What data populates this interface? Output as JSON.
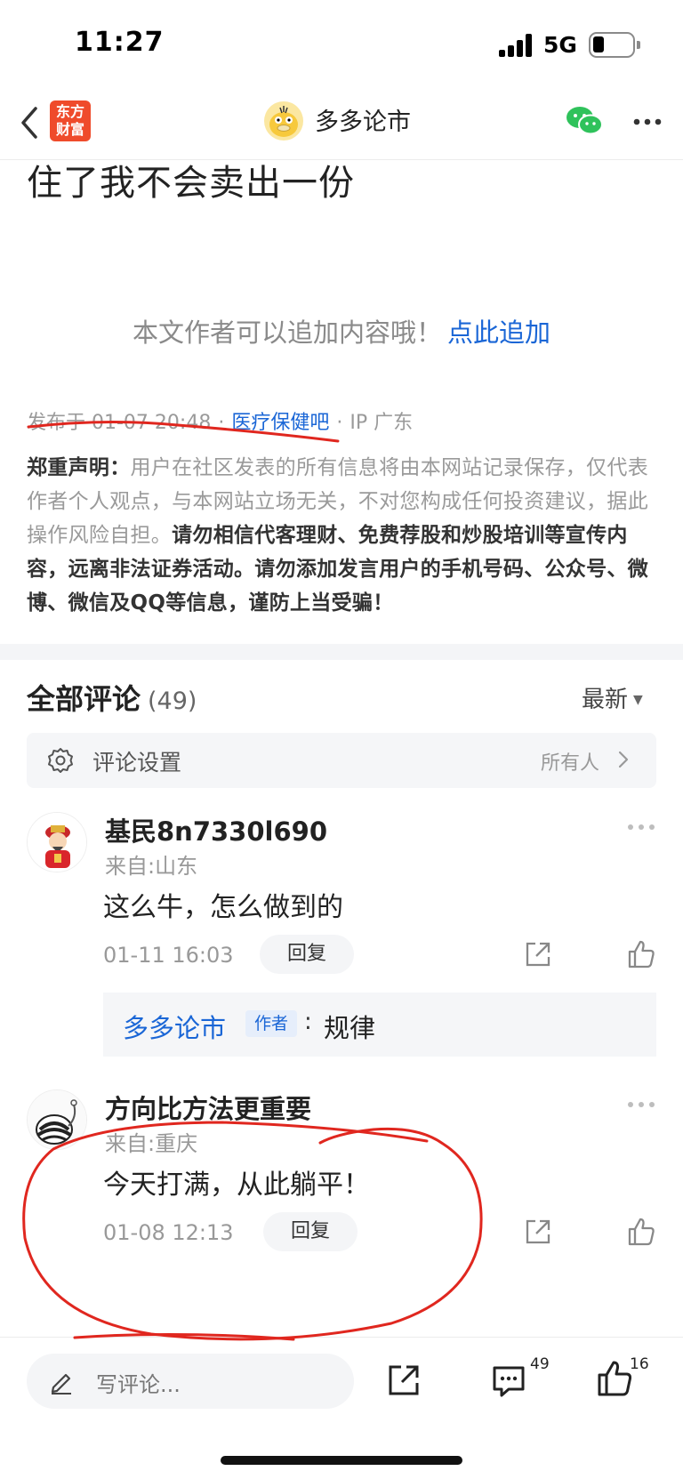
{
  "status_bar": {
    "time": "11:27",
    "network": "5G"
  },
  "nav": {
    "brand_logo_line1": "东方",
    "brand_logo_line2": "财富",
    "title": "多多论市"
  },
  "article": {
    "tail_text": "住了我不会卖出一份",
    "append_prompt": "本文作者可以追加内容哦！",
    "append_link": "点此追加",
    "published": "发布于 01-07 20:48",
    "bar_name": "医疗保健吧",
    "ip": "IP 广东",
    "disclaimer_label": "郑重声明：",
    "disclaimer_plain": "用户在社区发表的所有信息将由本网站记录保存，仅代表作者个人观点，与本网站立场无关，不对您构成任何投资建议，据此操作风险自担。",
    "disclaimer_bold": "请勿相信代客理财、免费荐股和炒股培训等宣传内容，远离非法证券活动。请勿添加发言用户的手机号码、公众号、微博、微信及QQ等信息，谨防上当受骗！"
  },
  "comments_section": {
    "title": "全部评论",
    "count": "(49)",
    "sort_label": "最新",
    "settings_label": "评论设置",
    "settings_value": "所有人"
  },
  "comments": [
    {
      "name": "基民8n7330l690",
      "from": "来自:山东",
      "text": "这么牛，怎么做到的",
      "time": "01-11 16:03",
      "reply_label": "回复",
      "sub_reply": {
        "name": "多多论市",
        "badge": "作者",
        "colon": ":",
        "text": "规律"
      }
    },
    {
      "name": "方向比方法更重要",
      "from": "来自:重庆",
      "text": "今天打满，从此躺平！",
      "time": "01-08 12:13",
      "reply_label": "回复"
    }
  ],
  "bottom_bar": {
    "input_placeholder": "写评论...",
    "comment_count": "49",
    "like_count": "16"
  },
  "colors": {
    "link_blue": "#1a66d6",
    "annotation_red": "#e0271f",
    "brand_orange": "#ef4b2b"
  }
}
